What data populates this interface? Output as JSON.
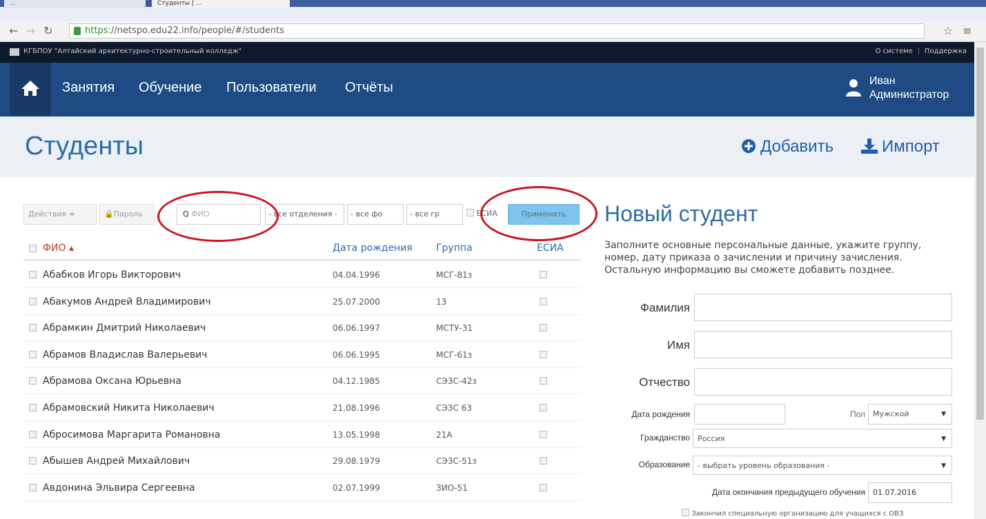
{
  "browser": {
    "tabs": [
      {
        "label": "...",
        "active": false
      },
      {
        "label": "Студенты | ...",
        "active": true
      }
    ],
    "url_scheme": "https",
    "url_rest": "://netspo.edu22.info/people/#/students"
  },
  "org": {
    "name": "КГБПОУ \"Алтайский архитектурно-строительный колледж\"",
    "links": [
      "О системе",
      "Поддержка"
    ]
  },
  "nav": {
    "items": [
      "Занятия",
      "Обучение",
      "Пользователи",
      "Отчёты"
    ],
    "user_first": "Иван",
    "user_role": "Администратор"
  },
  "page": {
    "title": "Студенты",
    "add_label": "Добавить",
    "import_label": "Импорт"
  },
  "toolbar": {
    "actions_label": "Действия ≑",
    "password_label": "🔒Пароль",
    "search_placeholder": "ФИО",
    "dept_select": "- все отделения -",
    "form_select": "- все фо",
    "group_select": "- все гр",
    "esia_label": "ЕСИА",
    "apply_label": "Применить"
  },
  "table": {
    "headers": {
      "name": "ФИО ▴",
      "dob": "Дата рождения",
      "group": "Группа",
      "esia": "ЕСИА"
    },
    "rows": [
      {
        "name": "Абабков Игорь Викторович",
        "dob": "04.04.1996",
        "group": "МСГ-81з"
      },
      {
        "name": "Абакумов Андрей Владимирович",
        "dob": "25.07.2000",
        "group": "13"
      },
      {
        "name": "Абрамкин Дмитрий Николаевич",
        "dob": "06.06.1997",
        "group": "МСТУ-31"
      },
      {
        "name": "Абрамов Владислав Валерьевич",
        "dob": "06.06.1995",
        "group": "МСГ-61з"
      },
      {
        "name": "Абрамова Оксана Юрьевна",
        "dob": "04.12.1985",
        "group": "СЭЗС-42з"
      },
      {
        "name": "Абрамовский Никита Николаевич",
        "dob": "21.08.1996",
        "group": "СЭЗС 63"
      },
      {
        "name": "Абросимова Маргарита Романовна",
        "dob": "13.05.1998",
        "group": "21А"
      },
      {
        "name": "Абышев Андрей Михайлович",
        "dob": "29.08.1979",
        "group": "СЭЗС-51з"
      },
      {
        "name": "Авдонина Эльвира Сергеевна",
        "dob": "02.07.1999",
        "group": "ЗИО-51"
      }
    ]
  },
  "form": {
    "title": "Новый студент",
    "description": "Заполните основные персональные данные, укажите группу, номер, дату приказа о зачислении и причину зачисления. Остальную информацию вы сможете добавить позднее.",
    "surname_label": "Фамилия",
    "name_label": "Имя",
    "patronymic_label": "Отчество",
    "dob_label": "Дата рождения",
    "gender_label": "Пол",
    "gender_value": "Мужской",
    "citizenship_label": "Гражданство",
    "citizenship_value": "Россия",
    "education_label": "Образование",
    "education_value": "- выбрать уровень образования -",
    "prev_end_label": "Дата окончания предыдущего обучения",
    "prev_end_value": "01.07.2016",
    "special_org_label": "Закончил специальную организацию для учащихся с ОВЗ"
  },
  "colors": {
    "nav_bg": "#1f4b85",
    "title_blue": "#2d6ba8",
    "apply_bg": "#7fc4ec",
    "annotation_red": "#c8141e"
  }
}
